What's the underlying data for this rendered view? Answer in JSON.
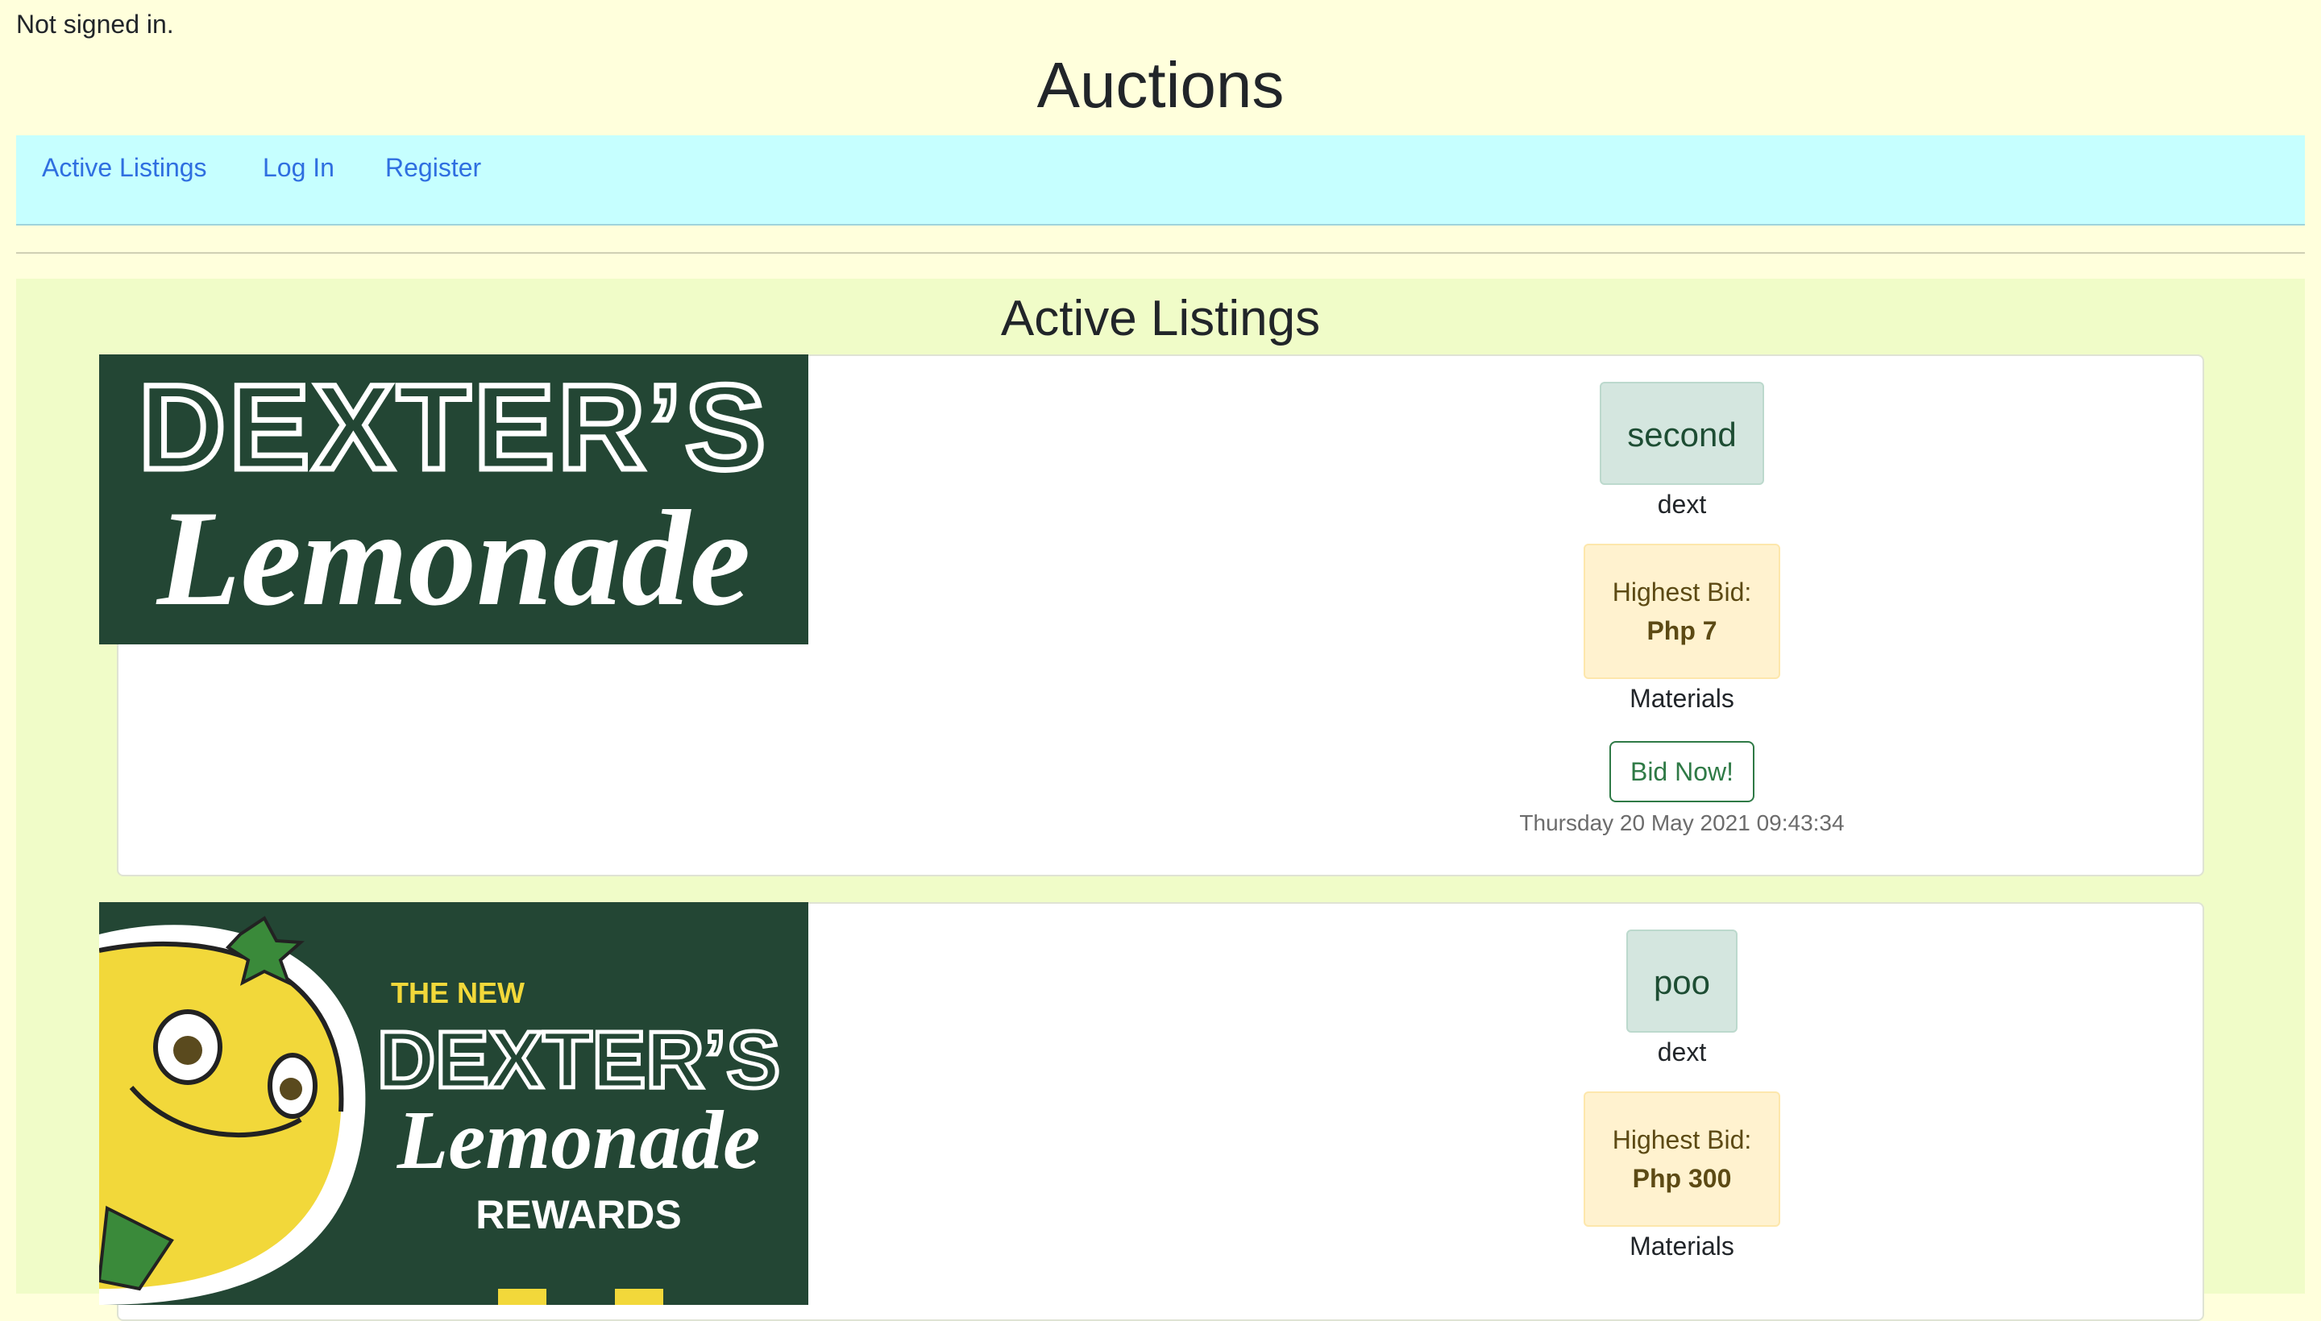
{
  "status": "Not signed in.",
  "site_title": "Auctions",
  "nav": {
    "active_listings": "Active Listings",
    "log_in": "Log In",
    "register": "Register"
  },
  "main_title": "Active Listings",
  "listings": [
    {
      "title": "second",
      "seller": "dext",
      "bid_label": "Highest Bid:",
      "bid_value": "Php 7",
      "category": "Materials",
      "bid_button": "Bid Now!",
      "date": "Thursday 20 May 2021 09:43:34",
      "image_line1": "DEXTER’S",
      "image_line2": "Lemonade"
    },
    {
      "title": "poo",
      "seller": "dext",
      "bid_label": "Highest Bid:",
      "bid_value": "Php 300",
      "category": "Materials",
      "image_line0": "THE NEW",
      "image_line1": "DEXTER’S",
      "image_line2": "Lemonade",
      "image_line3": "REWARDS"
    }
  ],
  "colors": {
    "page_bg": "#ffffdc",
    "nav_bg": "#c6ffff",
    "main_bg": "#f0fcc8",
    "image_bg": "#234634",
    "link": "#2f6fe0",
    "button_green": "#2f7a46"
  }
}
